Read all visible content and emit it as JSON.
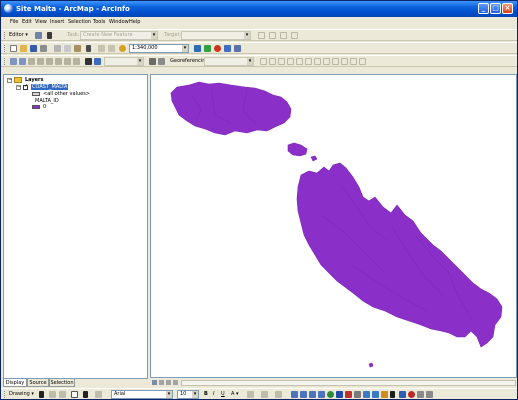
{
  "window": {
    "title": "Site Malta - ArcMap - ArcInfo",
    "minimize_glyph": "_",
    "maximize_glyph": "□",
    "close_glyph": "×"
  },
  "menu": [
    {
      "label": "File"
    },
    {
      "label": "Edit"
    },
    {
      "label": "View"
    },
    {
      "label": "Insert"
    },
    {
      "label": "Selection"
    },
    {
      "label": "Tools"
    },
    {
      "label": "Window"
    },
    {
      "label": "Help"
    }
  ],
  "editor_toolbar": {
    "editor_label": "Editor ▾",
    "task_label": "Task:",
    "task_value": "Create New Feature",
    "target_label": "Target:",
    "target_value": ""
  },
  "standard_toolbar": {
    "scale_value": "1:340,000"
  },
  "georef_toolbar": {
    "georef_label": "Georeferencing ▾",
    "layer_value": ""
  },
  "toc": {
    "root_label": "Layers",
    "layer_label": "COAST_MALTA",
    "legend_rows": [
      {
        "label": "<all other values>"
      },
      {
        "label": "MALTA_ID"
      },
      {
        "label": "0"
      }
    ],
    "tabs": [
      {
        "label": "Display"
      },
      {
        "label": "Source"
      },
      {
        "label": "Selection"
      }
    ]
  },
  "map": {
    "fill_color": "#8b2fc9",
    "stroke_color": "#7a26b3",
    "background": "#ffffff"
  },
  "drawing_toolbar": {
    "drawing_label": "Drawing ▾",
    "font_name": "Arial",
    "font_size": "10"
  }
}
